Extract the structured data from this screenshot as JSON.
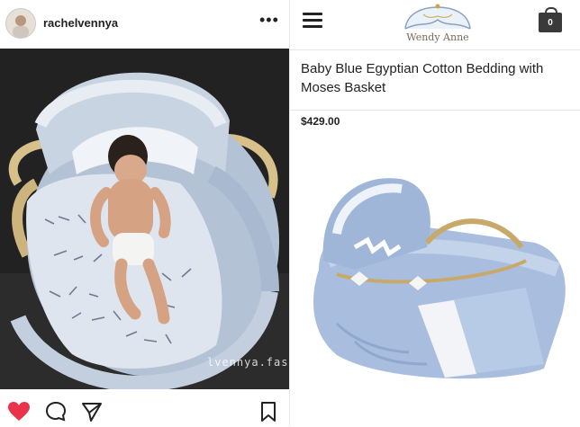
{
  "instagram": {
    "username": "rachelvennya",
    "more_label": "•••",
    "watermark": "@rachelvennya.fashion",
    "watermark_visible": "lvennya.fashion",
    "icons": [
      "avatar",
      "more-icon",
      "heart-icon",
      "comment-icon",
      "share-icon",
      "bookmark-icon"
    ]
  },
  "store": {
    "logo_text": "Wendy Anne",
    "cart_count": "0",
    "product_title": "Baby Blue Egyptian Cotton Bedding with Moses Basket",
    "price": "$429.00"
  },
  "colors": {
    "ig_heart": "#e8334a",
    "bedding_blue": "#a9bedf",
    "wicker": "#d8c08a"
  }
}
